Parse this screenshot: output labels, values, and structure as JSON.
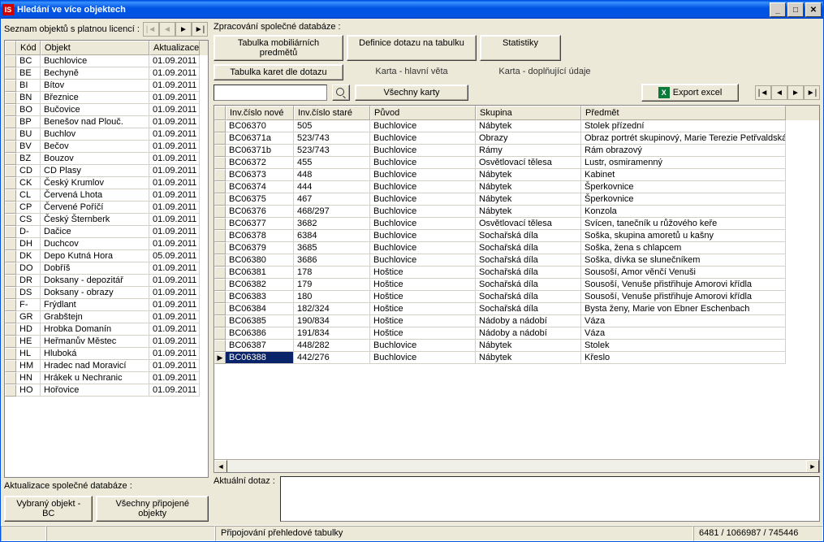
{
  "window": {
    "title": "Hledání ve více objektech"
  },
  "left": {
    "label": "Seznam objektů s platnou licencí :",
    "headers": {
      "kod": "Kód",
      "objekt": "Objekt",
      "aktualizace": "Aktualizace"
    },
    "rows": [
      {
        "kod": "BC",
        "obj": "Buchlovice",
        "akt": "01.09.2011"
      },
      {
        "kod": "BE",
        "obj": "Bechyně",
        "akt": "01.09.2011"
      },
      {
        "kod": "BI",
        "obj": "Bítov",
        "akt": "01.09.2011"
      },
      {
        "kod": "BN",
        "obj": "Březnice",
        "akt": "01.09.2011"
      },
      {
        "kod": "BO",
        "obj": "Bučovice",
        "akt": "01.09.2011"
      },
      {
        "kod": "BP",
        "obj": "Benešov nad Plouč.",
        "akt": "01.09.2011"
      },
      {
        "kod": "BU",
        "obj": "Buchlov",
        "akt": "01.09.2011"
      },
      {
        "kod": "BV",
        "obj": "Bečov",
        "akt": "01.09.2011"
      },
      {
        "kod": "BZ",
        "obj": "Bouzov",
        "akt": "01.09.2011"
      },
      {
        "kod": "CD",
        "obj": "CD Plasy",
        "akt": "01.09.2011"
      },
      {
        "kod": "CK",
        "obj": "Český Krumlov",
        "akt": "01.09.2011"
      },
      {
        "kod": "CL",
        "obj": "Červená Lhota",
        "akt": "01.09.2011"
      },
      {
        "kod": "CP",
        "obj": "Červené Poříčí",
        "akt": "01.09.2011"
      },
      {
        "kod": "CS",
        "obj": "Český Šternberk",
        "akt": "01.09.2011"
      },
      {
        "kod": "D-",
        "obj": "Dačice",
        "akt": "01.09.2011"
      },
      {
        "kod": "DH",
        "obj": "Duchcov",
        "akt": "01.09.2011"
      },
      {
        "kod": "DK",
        "obj": "Depo Kutná Hora",
        "akt": "05.09.2011"
      },
      {
        "kod": "DO",
        "obj": "Dobříš",
        "akt": "01.09.2011"
      },
      {
        "kod": "DR",
        "obj": "Doksany - depozitář",
        "akt": "01.09.2011"
      },
      {
        "kod": "DS",
        "obj": "Doksany - obrazy",
        "akt": "01.09.2011"
      },
      {
        "kod": "F-",
        "obj": "Frýdlant",
        "akt": "01.09.2011"
      },
      {
        "kod": "GR",
        "obj": "Grabštejn",
        "akt": "01.09.2011"
      },
      {
        "kod": "HD",
        "obj": "Hrobka Domanín",
        "akt": "01.09.2011"
      },
      {
        "kod": "HE",
        "obj": "Heřmanův Městec",
        "akt": "01.09.2011"
      },
      {
        "kod": "HL",
        "obj": "Hluboká",
        "akt": "01.09.2011"
      },
      {
        "kod": "HM",
        "obj": "Hradec nad Moravicí",
        "akt": "01.09.2011"
      },
      {
        "kod": "HN",
        "obj": "Hrákek u Nechranic",
        "akt": "01.09.2011"
      },
      {
        "kod": "HO",
        "obj": "Hořovice",
        "akt": "01.09.2011"
      }
    ],
    "update_label": "Aktualizace společné databáze :",
    "btn_selected": "Vybraný objekt - BC",
    "btn_all": "Všechny připojené objekty"
  },
  "right": {
    "label": "Zpracování společné databáze :",
    "tabs": {
      "t1": "Tabulka mobiliárních predmětů",
      "t2": "Definice dotazu na tabulku",
      "t3": "Statistiky",
      "t4": "Tabulka karet dle dotazu",
      "t5": "Karta - hlavní věta",
      "t6": "Karta - doplňující údaje"
    },
    "btn_all_cards": "Všechny karty",
    "btn_export": "Export excel",
    "grid_headers": {
      "c1": "Inv.číslo nové",
      "c2": "Inv.číslo staré",
      "c3": "Původ",
      "c4": "Skupina",
      "c5": "Předmět"
    },
    "rows": [
      {
        "c1": "BC06370",
        "c2": "505",
        "c3": "Buchlovice",
        "c4": "Nábytek",
        "c5": "Stolek přízední"
      },
      {
        "c1": "BC06371a",
        "c2": "523/743",
        "c3": "Buchlovice",
        "c4": "Obrazy",
        "c5": "Obraz portrét skupinový, Marie Terezie Petřvaldská a"
      },
      {
        "c1": "BC06371b",
        "c2": "523/743",
        "c3": "Buchlovice",
        "c4": "Rámy",
        "c5": "Rám obrazový"
      },
      {
        "c1": "BC06372",
        "c2": "455",
        "c3": "Buchlovice",
        "c4": "Osvětlovací tělesa",
        "c5": "Lustr, osmiramenný"
      },
      {
        "c1": "BC06373",
        "c2": "448",
        "c3": "Buchlovice",
        "c4": "Nábytek",
        "c5": "Kabinet"
      },
      {
        "c1": "BC06374",
        "c2": "444",
        "c3": "Buchlovice",
        "c4": "Nábytek",
        "c5": "Šperkovnice"
      },
      {
        "c1": "BC06375",
        "c2": "467",
        "c3": "Buchlovice",
        "c4": "Nábytek",
        "c5": "Šperkovnice"
      },
      {
        "c1": "BC06376",
        "c2": "468/297",
        "c3": "Buchlovice",
        "c4": "Nábytek",
        "c5": "Konzola"
      },
      {
        "c1": "BC06377",
        "c2": "3682",
        "c3": "Buchlovice",
        "c4": "Osvětlovací tělesa",
        "c5": "Svícen, tanečník u růžového keře"
      },
      {
        "c1": "BC06378",
        "c2": "6384",
        "c3": "Buchlovice",
        "c4": "Sochařská díla",
        "c5": "Soška, skupina amoretů u kašny"
      },
      {
        "c1": "BC06379",
        "c2": "3685",
        "c3": "Buchlovice",
        "c4": "Sochařská díla",
        "c5": "Soška, žena s chlapcem"
      },
      {
        "c1": "BC06380",
        "c2": "3686",
        "c3": "Buchlovice",
        "c4": "Sochařská díla",
        "c5": "Soška, dívka se slunečníkem"
      },
      {
        "c1": "BC06381",
        "c2": "178",
        "c3": "Hoštice",
        "c4": "Sochařská díla",
        "c5": "Sousoší, Amor věnčí Venuši"
      },
      {
        "c1": "BC06382",
        "c2": "179",
        "c3": "Hoštice",
        "c4": "Sochařská díla",
        "c5": "Sousoší, Venuše přistřihuje Amorovi křídla"
      },
      {
        "c1": "BC06383",
        "c2": "180",
        "c3": "Hoštice",
        "c4": "Sochařská díla",
        "c5": "Sousoší, Venuše přistřihuje Amorovi křídla"
      },
      {
        "c1": "BC06384",
        "c2": "182/324",
        "c3": "Hoštice",
        "c4": "Sochařská díla",
        "c5": "Bysta ženy, Marie von Ebner Eschenbach"
      },
      {
        "c1": "BC06385",
        "c2": "190/834",
        "c3": "Hoštice",
        "c4": "Nádoby a nádobí",
        "c5": "Váza"
      },
      {
        "c1": "BC06386",
        "c2": "191/834",
        "c3": "Hoštice",
        "c4": "Nádoby a nádobí",
        "c5": "Váza"
      },
      {
        "c1": "BC06387",
        "c2": "448/282",
        "c3": "Buchlovice",
        "c4": "Nábytek",
        "c5": "Stolek"
      },
      {
        "c1": "BC06388",
        "c2": "442/276",
        "c3": "Buchlovice",
        "c4": "Nábytek",
        "c5": "Křeslo"
      }
    ],
    "selected_index": 19,
    "dotaz_label": "Aktuální dotaz :"
  },
  "status": {
    "mid": "Připojování přehledové tabulky",
    "right": "6481 / 1066987 / 745446"
  }
}
